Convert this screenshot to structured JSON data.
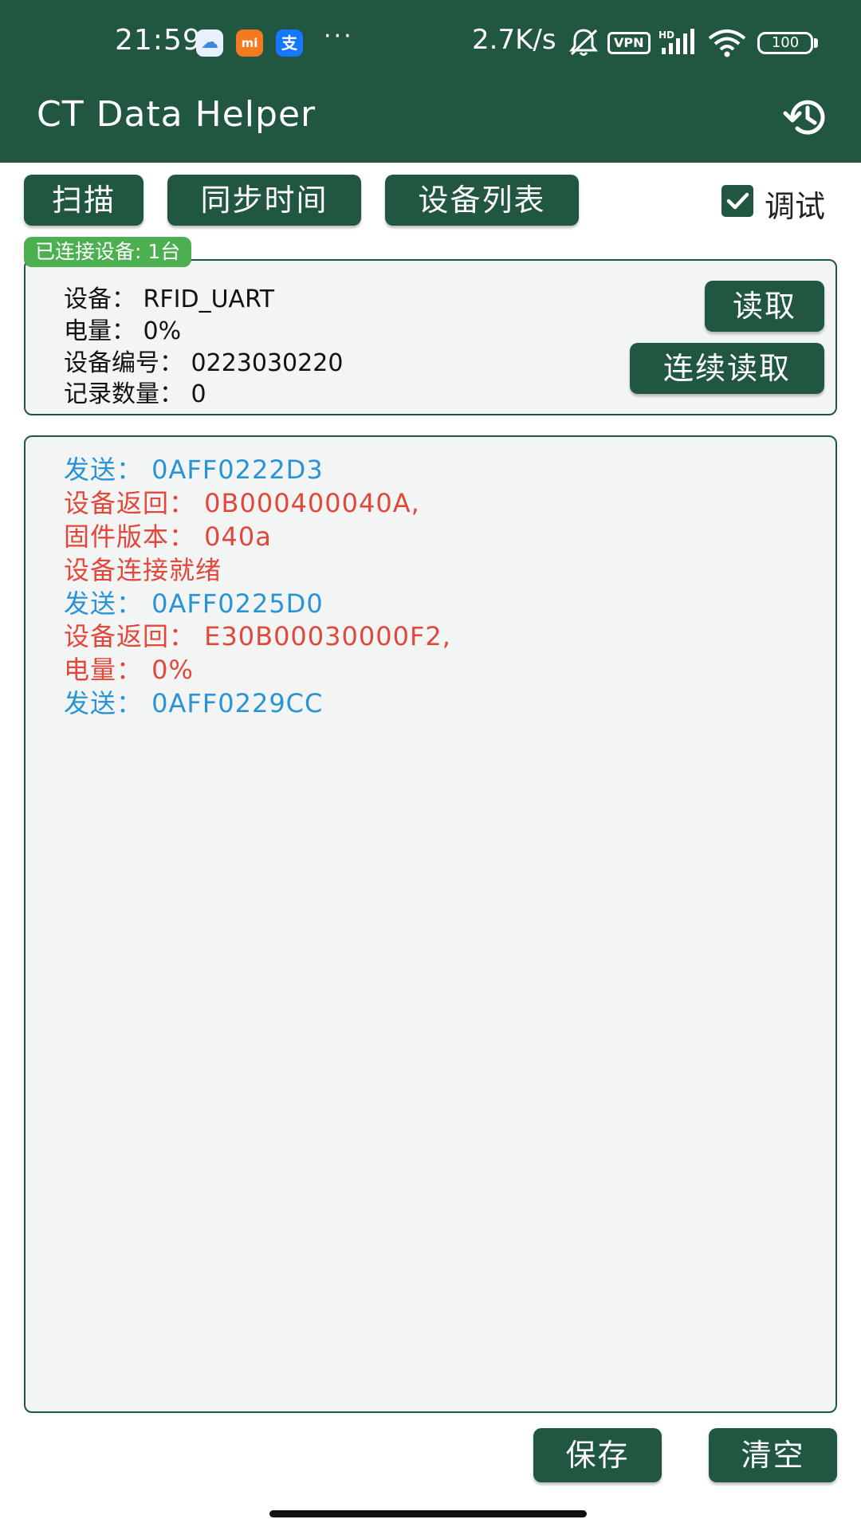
{
  "status_bar": {
    "time": "21:59",
    "notification_icons": [
      "cloud-icon",
      "mi-icon",
      "alipay-icon"
    ],
    "mi_label": "mi",
    "alipay_label": "支",
    "more_dots": "···",
    "net_speed": "2.7K/s",
    "vpn_label": "VPN",
    "battery_level": "100"
  },
  "app_bar": {
    "title": "CT Data Helper",
    "history_icon": "history-icon"
  },
  "toolbar": {
    "scan_label": "扫描",
    "sync_time_label": "同步时间",
    "device_list_label": "设备列表",
    "debug_label": "调试",
    "debug_checked": true
  },
  "device_panel": {
    "badge": "已连接设备: 1台",
    "device_line": "设备： RFID_UART",
    "battery_line": "电量： 0%",
    "device_id_line": "设备编号： 0223030220",
    "record_count_line": "记录数量： 0",
    "read_label": "读取",
    "continuous_read_label": "连续读取"
  },
  "log": {
    "lines": [
      {
        "type": "send",
        "text": "发送： 0AFF0222D3"
      },
      {
        "type": "recv",
        "text": "设备返回： 0B000400040A,"
      },
      {
        "type": "recv",
        "text": "固件版本： 040a"
      },
      {
        "type": "recv",
        "text": "设备连接就绪"
      },
      {
        "type": "send",
        "text": "发送： 0AFF0225D0"
      },
      {
        "type": "recv",
        "text": "设备返回： E30B00030000F2,"
      },
      {
        "type": "recv",
        "text": "电量： 0%"
      },
      {
        "type": "send",
        "text": "发送： 0AFF0229CC"
      }
    ]
  },
  "footer": {
    "save_label": "保存",
    "clear_label": "清空"
  },
  "colors": {
    "primary": "#215640",
    "badge_green": "#4caf50",
    "send_blue": "#2a93d5",
    "recv_red": "#e2473c",
    "panel_bg": "#f3f5f4"
  }
}
